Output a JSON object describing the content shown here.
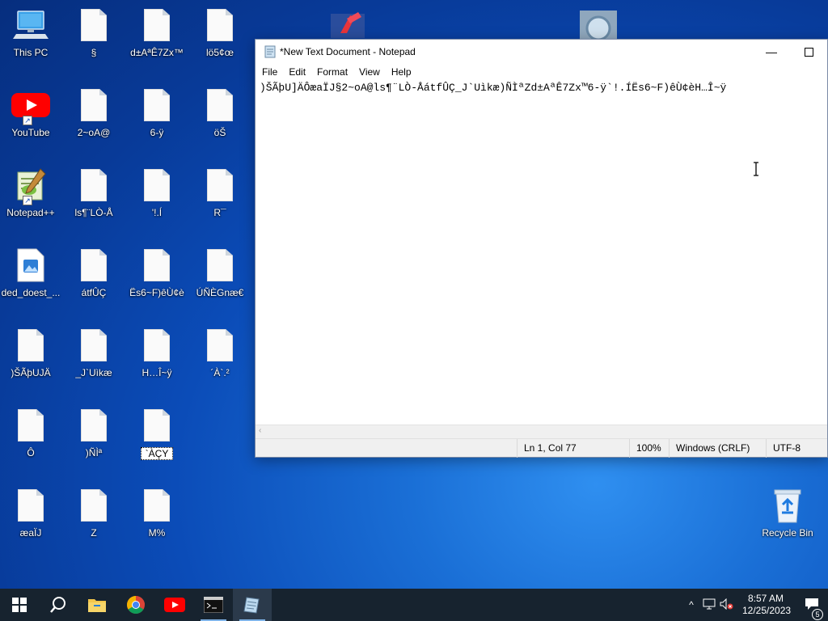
{
  "desktop": {
    "icons": [
      {
        "label": "This PC"
      },
      {
        "label": "§"
      },
      {
        "label": "d±AªÊ7Zx™"
      },
      {
        "label": "lö5¢œ"
      },
      {
        "label": "YouTube"
      },
      {
        "label": "2~oA@"
      },
      {
        "label": "6-ÿ"
      },
      {
        "label": "öŠ"
      },
      {
        "label": "Notepad++"
      },
      {
        "label": "ls¶¨LÒ-Å"
      },
      {
        "label": "'!.Í"
      },
      {
        "label": "R¯"
      },
      {
        "label": "ded_doest_..."
      },
      {
        "label": "átfÛÇ"
      },
      {
        "label": "Ës6~F)êÙ¢è"
      },
      {
        "label": "ÚÑÈGnæ€"
      },
      {
        "label": ")ŠÃþUJÄ"
      },
      {
        "label": "_J`Uìkæ"
      },
      {
        "label": "H…Î~ÿ"
      },
      {
        "label": "´À`.²"
      },
      {
        "label": "Ô"
      },
      {
        "label": ")ÑÌª"
      },
      {
        "label": "`ÀÇY"
      },
      {
        "label": "æaÏJ"
      },
      {
        "label": "Z"
      },
      {
        "label": "M%"
      },
      {
        "label": "Recycle Bin"
      }
    ]
  },
  "notepad": {
    "title": "*New Text Document - Notepad",
    "menu": [
      "File",
      "Edit",
      "Format",
      "View",
      "Help"
    ],
    "content": ")ŠÃþU]ÄÔæaÏJ§2~oA@ls¶¨LÒ-ÅátfÛÇ_J`Uìkæ)ÑÌªZd±AªÊ7Zx™6-ÿ`!.ÍËs6~F)êÙ¢èH…Î~ÿ",
    "status": {
      "position": "Ln 1, Col 77",
      "zoom": "100%",
      "line_ending": "Windows (CRLF)",
      "encoding": "UTF-8"
    }
  },
  "taskbar": {
    "clock_time": "8:57 AM",
    "clock_date": "12/25/2023",
    "notification_count": "5"
  },
  "colors": {
    "taskbar": "#17232f",
    "desktop_accent": "#1a6fd6"
  }
}
